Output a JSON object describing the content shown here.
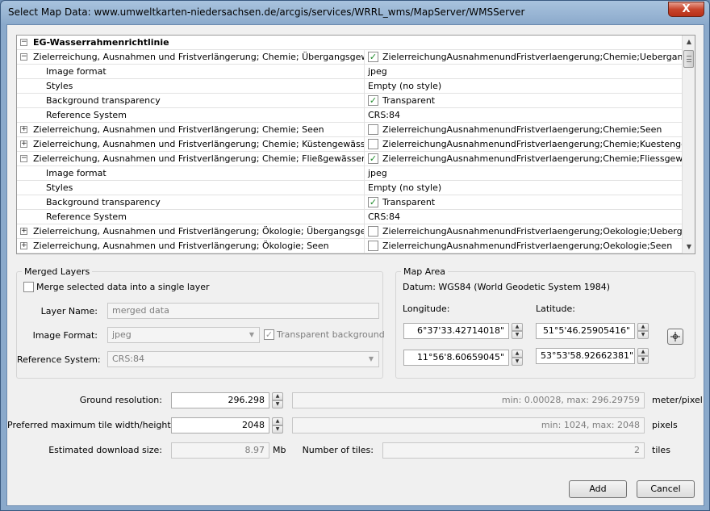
{
  "window": {
    "title": "Select Map Data: www.umweltkarten-niedersachsen.de/arcgis/services/WRRL_wms/MapServer/WMSServer",
    "close_glyph": "X"
  },
  "tree": {
    "group_title": "EG-Wasserrahmenrichtlinie",
    "rows": [
      {
        "kind": "layer",
        "expanded": true,
        "name": "Zielerreichung, Ausnahmen und Fristverlängerung; Chemie; Übergangsgewässer",
        "checked": true,
        "value": "ZielerreichungAusnahmenundFristverlaengerung;Chemie;Uebergangsgewaesser"
      },
      {
        "kind": "prop",
        "name": "Image format",
        "value": "jpeg"
      },
      {
        "kind": "prop",
        "name": "Styles",
        "value": "Empty (no style)"
      },
      {
        "kind": "propcheck",
        "name": "Background transparency",
        "checked": true,
        "value": "Transparent"
      },
      {
        "kind": "prop",
        "name": "Reference System",
        "value": "CRS:84"
      },
      {
        "kind": "layer",
        "expanded": false,
        "name": "Zielerreichung, Ausnahmen und Fristverlängerung; Chemie; Seen",
        "checked": false,
        "value": "ZielerreichungAusnahmenundFristverlaengerung;Chemie;Seen"
      },
      {
        "kind": "layer",
        "expanded": false,
        "name": "Zielerreichung, Ausnahmen und Fristverlängerung; Chemie; Küstengewässer",
        "checked": false,
        "value": "ZielerreichungAusnahmenundFristverlaengerung;Chemie;Kuestengewaesser"
      },
      {
        "kind": "layer",
        "expanded": true,
        "name": "Zielerreichung, Ausnahmen und Fristverlängerung; Chemie; Fließgewässer",
        "checked": true,
        "value": "ZielerreichungAusnahmenundFristverlaengerung;Chemie;Fliessgewaesser"
      },
      {
        "kind": "prop",
        "name": "Image format",
        "value": "jpeg"
      },
      {
        "kind": "prop",
        "name": "Styles",
        "value": "Empty (no style)"
      },
      {
        "kind": "propcheck",
        "name": "Background transparency",
        "checked": true,
        "value": "Transparent"
      },
      {
        "kind": "prop",
        "name": "Reference System",
        "value": "CRS:84"
      },
      {
        "kind": "layer",
        "expanded": false,
        "name": "Zielerreichung, Ausnahmen und Fristverlängerung; Ökologie; Übergangsgewässer",
        "checked": false,
        "value": "ZielerreichungAusnahmenundFristverlaengerung;Oekologie;Uebergangsgewaesser"
      },
      {
        "kind": "layer",
        "expanded": false,
        "name": "Zielerreichung, Ausnahmen und Fristverlängerung; Ökologie; Seen",
        "checked": false,
        "value": "ZielerreichungAusnahmenundFristverlaengerung;Oekologie;Seen"
      }
    ]
  },
  "merged": {
    "title": "Merged Layers",
    "merge_label": "Merge selected data into a single layer",
    "merge_checked": false,
    "layer_name_label": "Layer Name:",
    "layer_name_value": "merged data",
    "image_format_label": "Image Format:",
    "image_format_value": "jpeg",
    "transparent_label": "Transparent background",
    "transparent_checked": true,
    "ref_system_label": "Reference System:",
    "ref_system_value": "CRS:84"
  },
  "map_area": {
    "title": "Map Area",
    "datum": "Datum: WGS84 (World Geodetic System 1984)",
    "longitude_label": "Longitude:",
    "latitude_label": "Latitude:",
    "lon1": "6°37'33.42714018\"",
    "lon2": "11°56'8.60659045\"",
    "lat1": "51°5'46.25905416\"",
    "lat2": "53°53'58.92662381\""
  },
  "settings": {
    "ground_res_label": "Ground resolution:",
    "ground_res_value": "296.298",
    "ground_res_range": "min: 0.00028, max: 296.29759",
    "ground_res_unit": "meter/pixel",
    "tile_label": "Preferred maximum tile width/height:",
    "tile_value": "2048",
    "tile_range": "min: 1024, max: 2048",
    "tile_unit": "pixels",
    "download_label": "Estimated download size:",
    "download_value": "8.97",
    "download_unit": "Mb",
    "tiles_label": "Number of tiles:",
    "tiles_value": "2",
    "tiles_unit": "tiles"
  },
  "buttons": {
    "add": "Add",
    "cancel": "Cancel"
  }
}
